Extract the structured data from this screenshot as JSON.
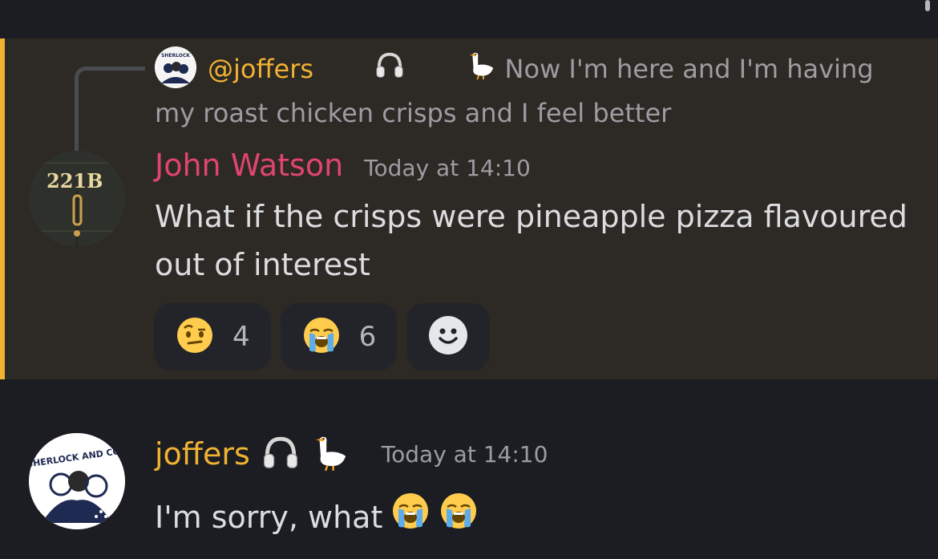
{
  "reply": {
    "username": "@joffers",
    "text": "Now I'm here and I'm having my roast chicken crisps and I feel better"
  },
  "message1": {
    "author": "John Watson",
    "timestamp": "Today at 14:10",
    "avatar_text": "221B",
    "text": "What if the crisps were pineapple pizza flavoured out of interest",
    "reactions": [
      {
        "emoji": "face-with-raised-eyebrow",
        "count": "4"
      },
      {
        "emoji": "loudly-crying-face",
        "count": "6"
      }
    ]
  },
  "message2": {
    "author": "joffers",
    "timestamp": "Today at 14:10",
    "avatar_text": "SHERLOCK AND CO.",
    "text": "I'm sorry, what",
    "emojis": [
      "loudly-crying-face",
      "loudly-crying-face"
    ]
  },
  "colors": {
    "highlight_bar": "#f0b232",
    "highlight_bg": "#2d2924",
    "watson_name": "#e0456d",
    "joffers_name": "#f0b232",
    "background": "#1c1d23"
  }
}
